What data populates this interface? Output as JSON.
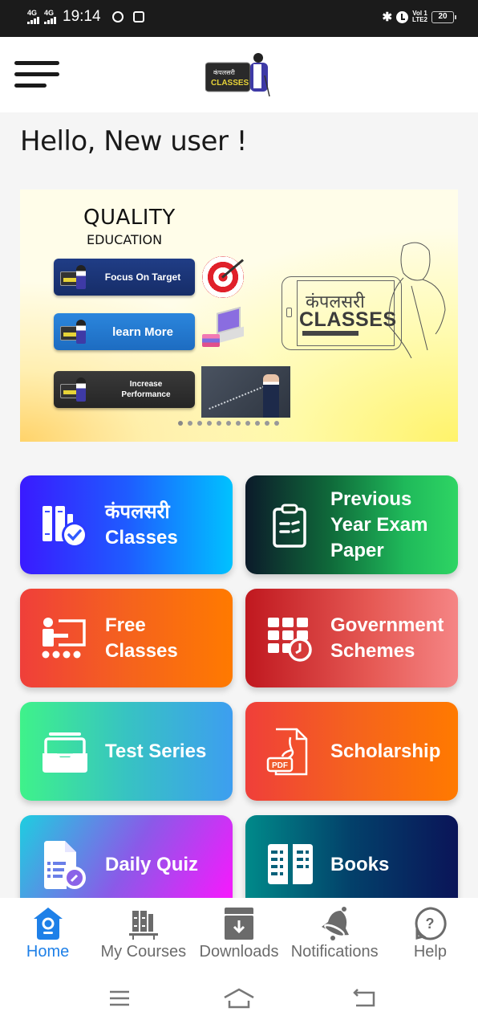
{
  "status_bar": {
    "signal_1": "4G",
    "signal_2": "4G",
    "time": "19:14",
    "notification_icons": [
      "whatsapp-icon",
      "instagram-icon"
    ],
    "right_icons": [
      "bluetooth-icon",
      "alarm-icon"
    ],
    "volte_line1": "Vol 1",
    "volte_line2": "LTE2",
    "battery": "20"
  },
  "app_bar": {
    "menu_icon": "hamburger-menu-icon",
    "logo_hindi": "कंपलसरी",
    "logo_text": "CLASSES"
  },
  "greeting": "Hello, New user !",
  "banner": {
    "title": "QUALITY",
    "subtitle": "EDUCATION",
    "buttons": [
      {
        "label": "Focus On Target"
      },
      {
        "label": "learn More"
      },
      {
        "label": "Increase Performance"
      }
    ],
    "brand_hindi": "कंपलसरी",
    "brand_text": "CLASSES",
    "carousel_dots": 11,
    "active_dot": 0
  },
  "tiles": [
    {
      "label": "कंपलसरी Classes",
      "line1": "कंपलसरी",
      "line2": "Classes",
      "icon": "books-check-icon"
    },
    {
      "label": "Previous Year Exam Paper",
      "line1": "Previous",
      "line2": "Year Exam",
      "line3": "Paper",
      "icon": "clipboard-icon"
    },
    {
      "label": "Free Classes",
      "line1": "Free",
      "line2": "Classes",
      "icon": "classroom-icon"
    },
    {
      "label": "Government Schemes",
      "line1": "Government",
      "line2": "Schemes",
      "icon": "calendar-clock-icon"
    },
    {
      "label": "Test Series",
      "line1": "Test Series",
      "icon": "tray-icon"
    },
    {
      "label": "Scholarship",
      "line1": "Scholarship",
      "icon": "pdf-icon"
    },
    {
      "label": "Daily Quiz",
      "line1": "Daily Quiz",
      "icon": "quiz-timer-icon"
    },
    {
      "label": "Books",
      "line1": "Books",
      "icon": "open-book-icon"
    }
  ],
  "bottom_nav": [
    {
      "label": "Home",
      "icon": "home-icon",
      "active": true
    },
    {
      "label": "My Courses",
      "icon": "bookshelf-icon",
      "active": false
    },
    {
      "label": "Downloads",
      "icon": "download-box-icon",
      "active": false
    },
    {
      "label": "Notifications",
      "icon": "bell-icon",
      "active": false
    },
    {
      "label": "Help",
      "icon": "help-icon",
      "active": false
    }
  ],
  "colors": {
    "accent": "#1e80e8",
    "inactive": "#6b6b6b"
  },
  "system_nav": [
    "recents-icon",
    "home-icon",
    "back-icon"
  ]
}
